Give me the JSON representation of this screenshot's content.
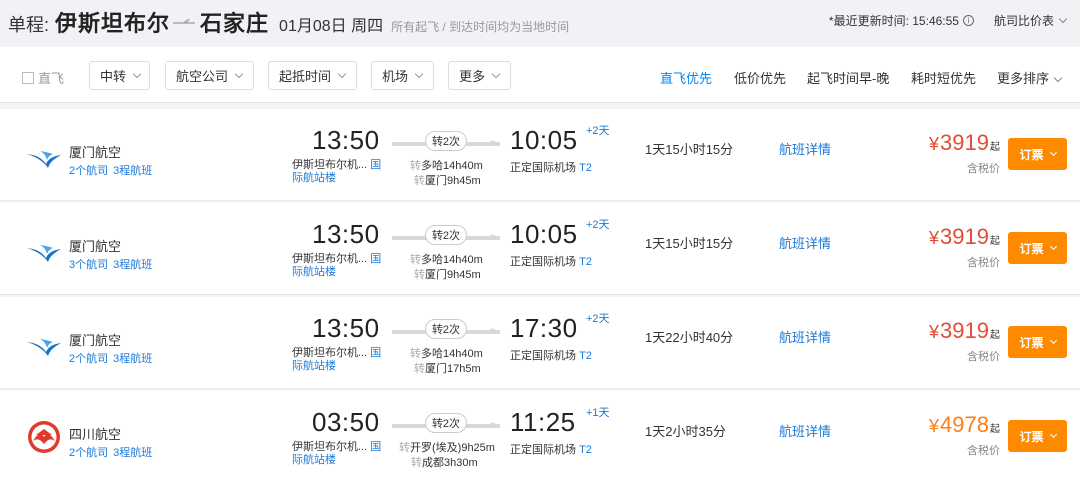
{
  "header": {
    "trip_type": "单程:",
    "from_city": "伊斯坦布尔",
    "to_city": "石家庄",
    "date": "01月08日 周四",
    "timezone_note": "所有起飞 / 到达时间均为当地时间",
    "updated_label": "*最近更新时间: 15:46:55",
    "compare_label": "航司比价表"
  },
  "filters": {
    "nonstop_label": "直飞",
    "dropdowns": [
      "中转",
      "航空公司",
      "起抵时间",
      "机场",
      "更多"
    ],
    "sorts": [
      "直飞优先",
      "低价优先",
      "起飞时间早-晚",
      "耗时短优先",
      "更多排序"
    ],
    "active_sort": "直飞优先"
  },
  "flights": [
    {
      "airline": "厦门航空",
      "airline_count": "2个航司",
      "legs": "3程航班",
      "logo": "xiamen-airlines-egret-logo",
      "dep_time": "13:50",
      "dep_airport": "伊斯坦布尔机...",
      "dep_terminal": "国际航站楼",
      "stops": "转2次",
      "transfer1": "多哈14h40m",
      "transfer2": "厦门9h45m",
      "arr_time": "10:05",
      "day_offset": "+2天",
      "arr_airport": "正定国际机场",
      "arr_terminal": "T2",
      "duration": "1天15小时15分",
      "detail": "航班详情",
      "currency": "¥",
      "price": "3919",
      "price_suffix": "起",
      "tax_note": "含税价",
      "book": "订票"
    },
    {
      "airline": "厦门航空",
      "airline_count": "3个航司",
      "legs": "3程航班",
      "logo": "xiamen-airlines-egret-logo",
      "dep_time": "13:50",
      "dep_airport": "伊斯坦布尔机...",
      "dep_terminal": "国际航站楼",
      "stops": "转2次",
      "transfer1": "多哈14h40m",
      "transfer2": "厦门9h45m",
      "arr_time": "10:05",
      "day_offset": "+2天",
      "arr_airport": "正定国际机场",
      "arr_terminal": "T2",
      "duration": "1天15小时15分",
      "detail": "航班详情",
      "currency": "¥",
      "price": "3919",
      "price_suffix": "起",
      "tax_note": "含税价",
      "book": "订票"
    },
    {
      "airline": "厦门航空",
      "airline_count": "2个航司",
      "legs": "3程航班",
      "logo": "xiamen-airlines-egret-logo",
      "dep_time": "13:50",
      "dep_airport": "伊斯坦布尔机...",
      "dep_terminal": "国际航站楼",
      "stops": "转2次",
      "transfer1": "多哈14h40m",
      "transfer2": "厦门17h5m",
      "arr_time": "17:30",
      "day_offset": "+2天",
      "arr_airport": "正定国际机场",
      "arr_terminal": "T2",
      "duration": "1天22小时40分",
      "detail": "航班详情",
      "currency": "¥",
      "price": "3919",
      "price_suffix": "起",
      "tax_note": "含税价",
      "book": "订票"
    },
    {
      "airline": "四川航空",
      "airline_count": "2个航司",
      "legs": "3程航班",
      "logo": "sichuan-airlines-logo",
      "dep_time": "03:50",
      "dep_airport": "伊斯坦布尔机...",
      "dep_terminal": "国际航站楼",
      "stops": "转2次",
      "transfer1": "开罗(埃及)9h25m",
      "transfer2": "成都3h30m",
      "arr_time": "11:25",
      "day_offset": "+1天",
      "arr_airport": "正定国际机场",
      "arr_terminal": "T2",
      "duration": "1天2小时35分",
      "detail": "航班详情",
      "currency": "¥",
      "price": "4978",
      "price_suffix": "起",
      "tax_note": "含税价",
      "book": "订票"
    }
  ],
  "transfer_prefix": "转",
  "colors": {
    "accent_blue": "#0086f6",
    "link_blue": "#1a7ad8",
    "price_red": "#e54b34",
    "price_orange": "#ff7d13",
    "book_orange": "#ff8a00"
  }
}
